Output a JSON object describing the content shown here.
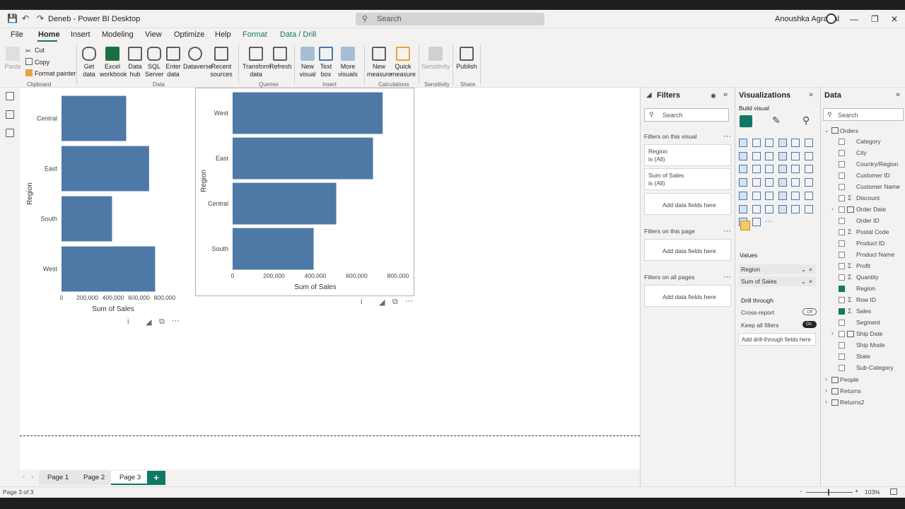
{
  "window": {
    "title": "Deneb - Power BI Desktop",
    "search_placeholder": "Search",
    "user": "Anoushka Agrawal"
  },
  "tabs": [
    "File",
    "Home",
    "Insert",
    "Modeling",
    "View",
    "Optimize",
    "Help",
    "Format",
    "Data / Drill"
  ],
  "ribbon": {
    "clipboard": {
      "paste": "Paste",
      "cut": "Cut",
      "copy": "Copy",
      "format_painter": "Format painter",
      "group": "Clipboard"
    },
    "data": {
      "get_data": [
        "Get",
        "data"
      ],
      "excel": [
        "Excel",
        "workbook"
      ],
      "hub": [
        "Data",
        "hub"
      ],
      "sql": [
        "SQL",
        "Server"
      ],
      "enter": [
        "Enter",
        "data"
      ],
      "dataverse": [
        "Dataverse"
      ],
      "recent": [
        "Recent",
        "sources"
      ],
      "group": "Data"
    },
    "queries": {
      "transform": [
        "Transform",
        "data"
      ],
      "refresh": [
        "Refresh"
      ],
      "group": "Queries"
    },
    "insert": {
      "new_visual": [
        "New",
        "visual"
      ],
      "text_box": [
        "Text",
        "box"
      ],
      "more_visuals": [
        "More",
        "visuals"
      ],
      "group": "Insert"
    },
    "calculations": {
      "new_measure": [
        "New",
        "measure"
      ],
      "quick_measure": [
        "Quick",
        "measure"
      ],
      "group": "Calculations"
    },
    "sensitivity": {
      "label": [
        "Sensitivity"
      ],
      "group": "Sensitivity"
    },
    "share": {
      "publish": [
        "Publish"
      ],
      "group": "Share"
    }
  },
  "chart_data": [
    {
      "type": "bar",
      "orientation": "horizontal",
      "categories": [
        "Central",
        "East",
        "South",
        "West"
      ],
      "values": [
        501240,
        678781,
        391722,
        725458
      ],
      "xlabel": "Sum of Sales",
      "ylabel": "Region",
      "xlim": [
        0,
        800000
      ],
      "xticks": [
        "0",
        "200,000",
        "400,000",
        "600,000",
        "800,000"
      ],
      "color": "#4e79a7"
    },
    {
      "type": "bar",
      "orientation": "horizontal",
      "categories": [
        "West",
        "East",
        "Central",
        "South"
      ],
      "values": [
        725458,
        678781,
        501240,
        391722
      ],
      "xlabel": "Sum of Sales",
      "ylabel": "Region",
      "xlim": [
        0,
        800000
      ],
      "xticks": [
        "0",
        "200,000",
        "400,000",
        "600,000",
        "800,000"
      ],
      "color": "#4e79a7"
    }
  ],
  "pages": {
    "tabs": [
      "Page 1",
      "Page 2",
      "Page 3"
    ],
    "active": "Page 3",
    "add": "+"
  },
  "filters": {
    "title": "Filters",
    "search_placeholder": "Search",
    "on_visual": "Filters on this visual",
    "cards": [
      {
        "name": "Region",
        "state": "is (All)"
      },
      {
        "name": "Sum of Sales",
        "state": "is (All)"
      }
    ],
    "add": "Add data fields here",
    "on_page": "Filters on this page",
    "on_all": "Filters on all pages"
  },
  "viz": {
    "title": "Visualizations",
    "build": "Build visual",
    "values_label": "Values",
    "wells": [
      "Region",
      "Sum of Sales"
    ],
    "drill": "Drill through",
    "cross": "Cross-report",
    "cross_state": "Off",
    "keep": "Keep all filters",
    "keep_state": "On",
    "add_drill": "Add drill-through fields here"
  },
  "data": {
    "title": "Data",
    "search_placeholder": "Search",
    "table": "Orders",
    "fields": [
      {
        "name": "Category",
        "sigma": false,
        "checked": false
      },
      {
        "name": "City",
        "sigma": false,
        "checked": false
      },
      {
        "name": "Country/Region",
        "sigma": false,
        "checked": false
      },
      {
        "name": "Customer ID",
        "sigma": false,
        "checked": false
      },
      {
        "name": "Customer Name",
        "sigma": false,
        "checked": false
      },
      {
        "name": "Discount",
        "sigma": true,
        "checked": false
      },
      {
        "name": "Order Date",
        "sigma": false,
        "checked": false,
        "expand": true
      },
      {
        "name": "Order ID",
        "sigma": false,
        "checked": false
      },
      {
        "name": "Postal Code",
        "sigma": true,
        "checked": false
      },
      {
        "name": "Product ID",
        "sigma": false,
        "checked": false
      },
      {
        "name": "Product Name",
        "sigma": false,
        "checked": false
      },
      {
        "name": "Profit",
        "sigma": true,
        "checked": false
      },
      {
        "name": "Quantity",
        "sigma": true,
        "checked": false
      },
      {
        "name": "Region",
        "sigma": false,
        "checked": true
      },
      {
        "name": "Row ID",
        "sigma": true,
        "checked": false
      },
      {
        "name": "Sales",
        "sigma": true,
        "checked": true
      },
      {
        "name": "Segment",
        "sigma": false,
        "checked": false
      },
      {
        "name": "Ship Date",
        "sigma": false,
        "checked": false,
        "expand": true
      },
      {
        "name": "Ship Mode",
        "sigma": false,
        "checked": false
      },
      {
        "name": "State",
        "sigma": false,
        "checked": false
      },
      {
        "name": "Sub-Category",
        "sigma": false,
        "checked": false
      }
    ],
    "other_tables": [
      "People",
      "Returns",
      "Returns2"
    ]
  },
  "status": {
    "page": "Page 3 of 3",
    "zoom": "103%"
  }
}
